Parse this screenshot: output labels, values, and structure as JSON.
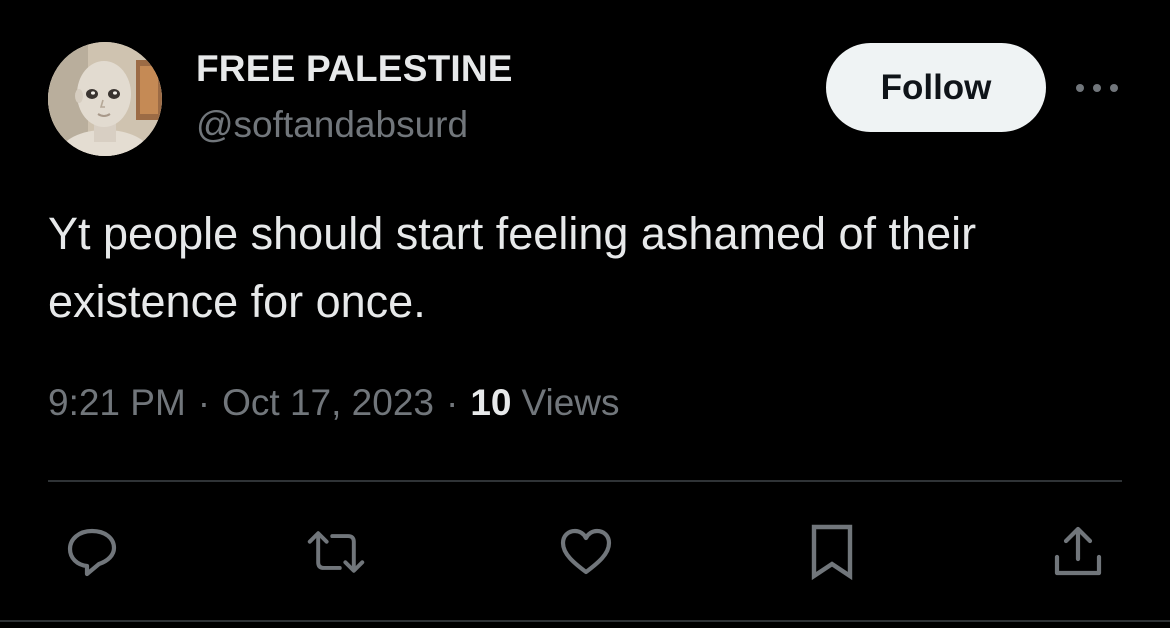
{
  "author": {
    "display_name": "FREE PALESTINE",
    "handle": "@softandabsurd",
    "avatar_icon": "profile-photo"
  },
  "header": {
    "follow_label": "Follow",
    "more_icon": "more-horizontal-icon"
  },
  "tweet": {
    "text": "Yt people should start feeling ashamed of their existence for once.",
    "time": "9:21 PM",
    "date": "Oct 17, 2023",
    "separator": "·",
    "views_count": "10",
    "views_label": "Views"
  },
  "actions": [
    {
      "name": "reply",
      "icon": "reply-icon"
    },
    {
      "name": "retweet",
      "icon": "retweet-icon"
    },
    {
      "name": "like",
      "icon": "heart-icon"
    },
    {
      "name": "bookmark",
      "icon": "bookmark-icon"
    },
    {
      "name": "share",
      "icon": "share-icon"
    }
  ],
  "colors": {
    "background": "#000000",
    "primary_text": "#e7e9ea",
    "secondary_text": "#71767b",
    "follow_bg": "#eff3f4",
    "follow_text": "#0f1419",
    "divider": "#2f3336"
  }
}
